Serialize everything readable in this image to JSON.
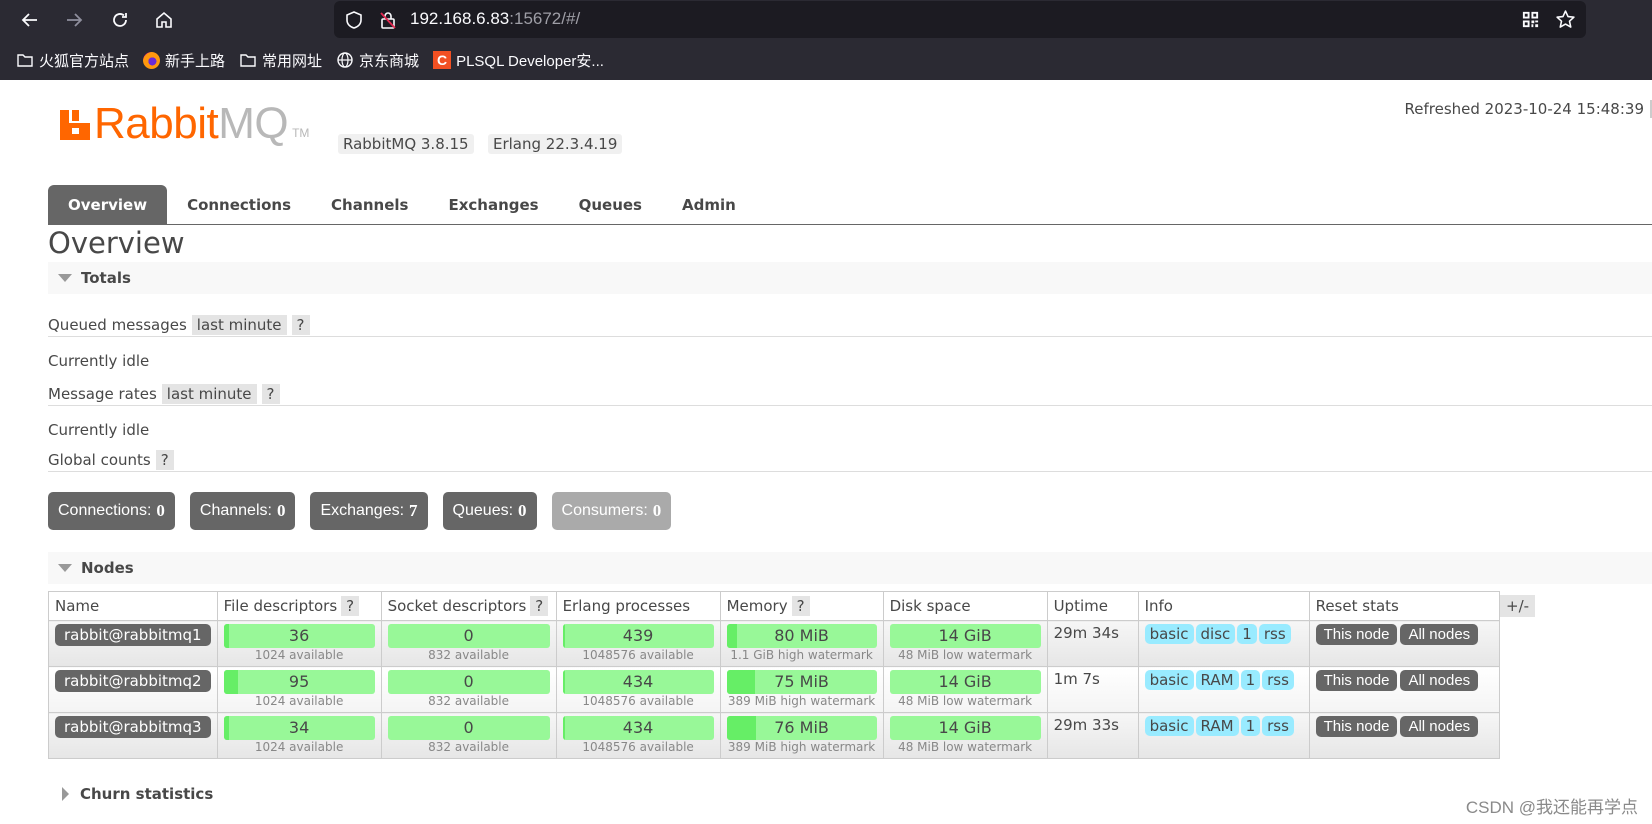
{
  "browser": {
    "url_host": "192.168.6.83",
    "url_rest": ":15672/#/",
    "bookmarks": [
      {
        "label": "火狐官方站点",
        "icon": "folder-icon"
      },
      {
        "label": "新手上路",
        "icon": "firefox-icon"
      },
      {
        "label": "常用网址",
        "icon": "folder-icon"
      },
      {
        "label": "京东商城",
        "icon": "globe-icon"
      },
      {
        "label": "PLSQL Developer安...",
        "icon": "csdn-icon"
      }
    ]
  },
  "header": {
    "logo_rabbit": "Rabbit",
    "logo_mq": "MQ",
    "logo_tm": "TM",
    "rabbitmq_version": "RabbitMQ 3.8.15",
    "erlang_version": "Erlang 22.3.4.19",
    "refreshed": "Refreshed 2023-10-24 15:48:39"
  },
  "tabs": [
    {
      "label": "Overview",
      "active": true
    },
    {
      "label": "Connections",
      "active": false
    },
    {
      "label": "Channels",
      "active": false
    },
    {
      "label": "Exchanges",
      "active": false
    },
    {
      "label": "Queues",
      "active": false
    },
    {
      "label": "Admin",
      "active": false
    }
  ],
  "page_title": "Overview",
  "totals": {
    "title": "Totals",
    "queued_label": "Queued messages",
    "queued_range": "last minute",
    "queued_status": "Currently idle",
    "rates_label": "Message rates",
    "rates_range": "last minute",
    "rates_status": "Currently idle",
    "global_label": "Global counts",
    "help": "?",
    "counts": [
      {
        "label": "Connections:",
        "value": "0"
      },
      {
        "label": "Channels:",
        "value": "0"
      },
      {
        "label": "Exchanges:",
        "value": "7"
      },
      {
        "label": "Queues:",
        "value": "0"
      },
      {
        "label": "Consumers:",
        "value": "0"
      }
    ]
  },
  "nodes": {
    "title": "Nodes",
    "columns": [
      "Name",
      "File descriptors",
      "Socket descriptors",
      "Erlang processes",
      "Memory",
      "Disk space",
      "Uptime",
      "Info",
      "Reset stats"
    ],
    "plus_minus": "+/-",
    "reset_this": "This node",
    "reset_all": "All nodes",
    "rows": [
      {
        "name": "rabbit@rabbitmq1",
        "fd": "36",
        "fd_sub": "1024 available",
        "fd_frac": 0.035,
        "sd": "0",
        "sd_sub": "832 available",
        "sd_frac": 0,
        "ep": "439",
        "ep_sub": "1048576 available",
        "ep_frac": 0.0004,
        "mem": "80 MiB",
        "mem_sub": "1.1 GiB high watermark",
        "mem_frac": 0.07,
        "disk": "14 GiB",
        "disk_sub": "48 MiB low watermark",
        "disk_frac": 0,
        "uptime": "29m 34s",
        "info": [
          "basic",
          "disc",
          "1",
          "rss"
        ]
      },
      {
        "name": "rabbit@rabbitmq2",
        "fd": "95",
        "fd_sub": "1024 available",
        "fd_frac": 0.093,
        "sd": "0",
        "sd_sub": "832 available",
        "sd_frac": 0,
        "ep": "434",
        "ep_sub": "1048576 available",
        "ep_frac": 0.0004,
        "mem": "75 MiB",
        "mem_sub": "389 MiB high watermark",
        "mem_frac": 0.19,
        "disk": "14 GiB",
        "disk_sub": "48 MiB low watermark",
        "disk_frac": 0,
        "uptime": "1m 7s",
        "info": [
          "basic",
          "RAM",
          "1",
          "rss"
        ]
      },
      {
        "name": "rabbit@rabbitmq3",
        "fd": "34",
        "fd_sub": "1024 available",
        "fd_frac": 0.033,
        "sd": "0",
        "sd_sub": "832 available",
        "sd_frac": 0,
        "ep": "434",
        "ep_sub": "1048576 available",
        "ep_frac": 0.0004,
        "mem": "76 MiB",
        "mem_sub": "389 MiB high watermark",
        "mem_frac": 0.195,
        "disk": "14 GiB",
        "disk_sub": "48 MiB low watermark",
        "disk_frac": 0,
        "uptime": "29m 33s",
        "info": [
          "basic",
          "RAM",
          "1",
          "rss"
        ]
      }
    ]
  },
  "churn": {
    "title": "Churn statistics"
  },
  "watermark": "CSDN @我还能再学点"
}
